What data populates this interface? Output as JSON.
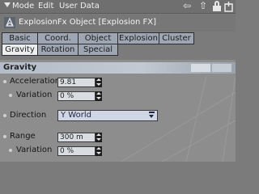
{
  "menubar": {
    "items": [
      {
        "label": "Mode"
      },
      {
        "label": "Edit"
      },
      {
        "label": "User Data"
      }
    ],
    "nav_back": "⇦",
    "nav_up": "⇧"
  },
  "title": "ExplosionFx Object [Explosion FX]",
  "tabs": [
    {
      "label": "Basic",
      "active": false
    },
    {
      "label": "Coord.",
      "active": false
    },
    {
      "label": "Object",
      "active": false
    },
    {
      "label": "Explosion",
      "active": false
    },
    {
      "label": "Cluster",
      "active": false
    },
    {
      "label": "Gravity",
      "active": true
    },
    {
      "label": "Rotation",
      "active": false
    },
    {
      "label": "Special",
      "active": false
    }
  ],
  "section": {
    "title": "Gravity"
  },
  "params": {
    "acceleration": {
      "label": "Acceleration",
      "value": "9.81"
    },
    "acceleration_variation": {
      "label": "Variation",
      "value": "0 %"
    },
    "direction": {
      "label": "Direction",
      "value": "Y World"
    },
    "range": {
      "label": "Range",
      "value": "300 m"
    },
    "range_variation": {
      "label": "Variation",
      "value": "0 %"
    }
  },
  "colors": {
    "tab_active": "#ecedef",
    "tab_inactive": "#9ea6b3",
    "panel_bg": "#8d8d8d"
  }
}
